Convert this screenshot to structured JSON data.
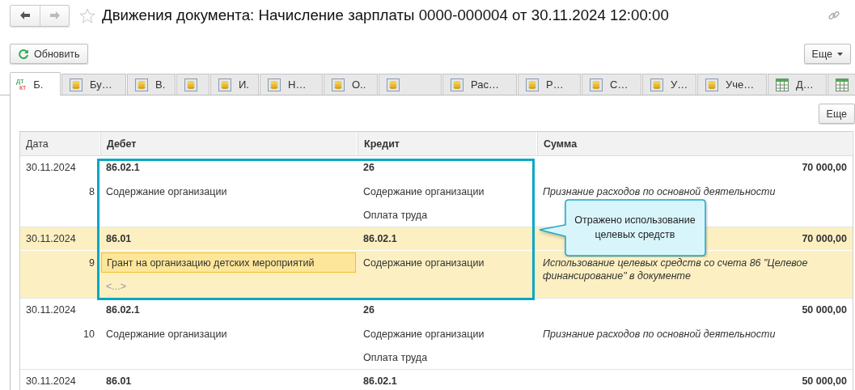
{
  "window": {
    "title": "Движения документа: Начисление зарплаты 0000-000004 от 30.11.2024 12:00:00",
    "favorite": false,
    "back_enabled": true,
    "forward_enabled": false
  },
  "toolbar": {
    "refresh_button": "Обновить",
    "more_button": "Еще"
  },
  "tabs": [
    {
      "label": "Б.",
      "kind": "entries",
      "icon_text": [
        "дт",
        "кт"
      ],
      "selected": true
    },
    {
      "label": "Бу…",
      "kind": "register",
      "selected": false
    },
    {
      "label": "В.",
      "kind": "register",
      "selected": false
    },
    {
      "kind": "register",
      "selected": false
    },
    {
      "label": "И.",
      "kind": "register",
      "selected": false
    },
    {
      "label": "Н…",
      "kind": "register",
      "selected": false
    },
    {
      "label": "О..",
      "kind": "register",
      "selected": false
    },
    {
      "kind": "register",
      "selected": false
    },
    {
      "label": "Рас…",
      "kind": "register",
      "selected": false
    },
    {
      "label": "Р…",
      "kind": "register",
      "selected": false
    },
    {
      "label": "С…",
      "kind": "register",
      "selected": false
    },
    {
      "label": "У…",
      "kind": "register",
      "selected": false
    },
    {
      "label": "Уче…",
      "kind": "register",
      "selected": false
    },
    {
      "label": "Д…",
      "kind": "table",
      "selected": false
    },
    {
      "kind": "table",
      "selected": false
    }
  ],
  "panel": {
    "more_button": "Еще"
  },
  "table": {
    "columns": [
      "Дата",
      "Дебет",
      "Кредит",
      "Сумма"
    ],
    "rows": [
      {
        "date": "30.11.2024",
        "number": "8",
        "debit": {
          "account": "86.02.1",
          "subconto": [
            {
              "text": "Содержание организации",
              "kind": "value",
              "focused": false
            }
          ]
        },
        "credit": {
          "account": "26",
          "subconto": [
            {
              "text": "Содержание организации",
              "kind": "value",
              "focused": false
            },
            {
              "text": "Оплата труда",
              "kind": "value",
              "focused": false
            }
          ]
        },
        "amount": "70 000,00",
        "comment": "Признание расходов по основной деятельности",
        "selected": false
      },
      {
        "date": "30.11.2024",
        "number": "9",
        "debit": {
          "account": "86.01",
          "subconto": [
            {
              "text": "Грант на организацию детских мероприятий",
              "kind": "value",
              "focused": true
            },
            {
              "text": "<...>",
              "kind": "empty",
              "focused": false
            }
          ]
        },
        "credit": {
          "account": "86.02.1",
          "subconto": [
            {
              "text": "Содержание организации",
              "kind": "value",
              "focused": false
            }
          ]
        },
        "amount": "70 000,00",
        "comment": "Использование целевых средств со счета 86 \"Целевое финансирование\" в документе",
        "selected": true
      },
      {
        "date": "30.11.2024",
        "number": "10",
        "debit": {
          "account": "86.02.1",
          "subconto": [
            {
              "text": "Содержание организации",
              "kind": "value",
              "focused": false
            }
          ]
        },
        "credit": {
          "account": "26",
          "subconto": [
            {
              "text": "Содержание организации",
              "kind": "value",
              "focused": false
            },
            {
              "text": "Оплата труда",
              "kind": "value",
              "focused": false
            }
          ]
        },
        "amount": "50 000,00",
        "comment": "Признание расходов по основной деятельности",
        "selected": false
      },
      {
        "date": "30.11.2024",
        "debit": {
          "account": "86.01"
        },
        "credit": {
          "account": "86.02.1"
        },
        "amount": "50 000,00",
        "selected": false
      }
    ]
  },
  "annotation": {
    "callout": "Отражено использование целевых средств"
  }
}
